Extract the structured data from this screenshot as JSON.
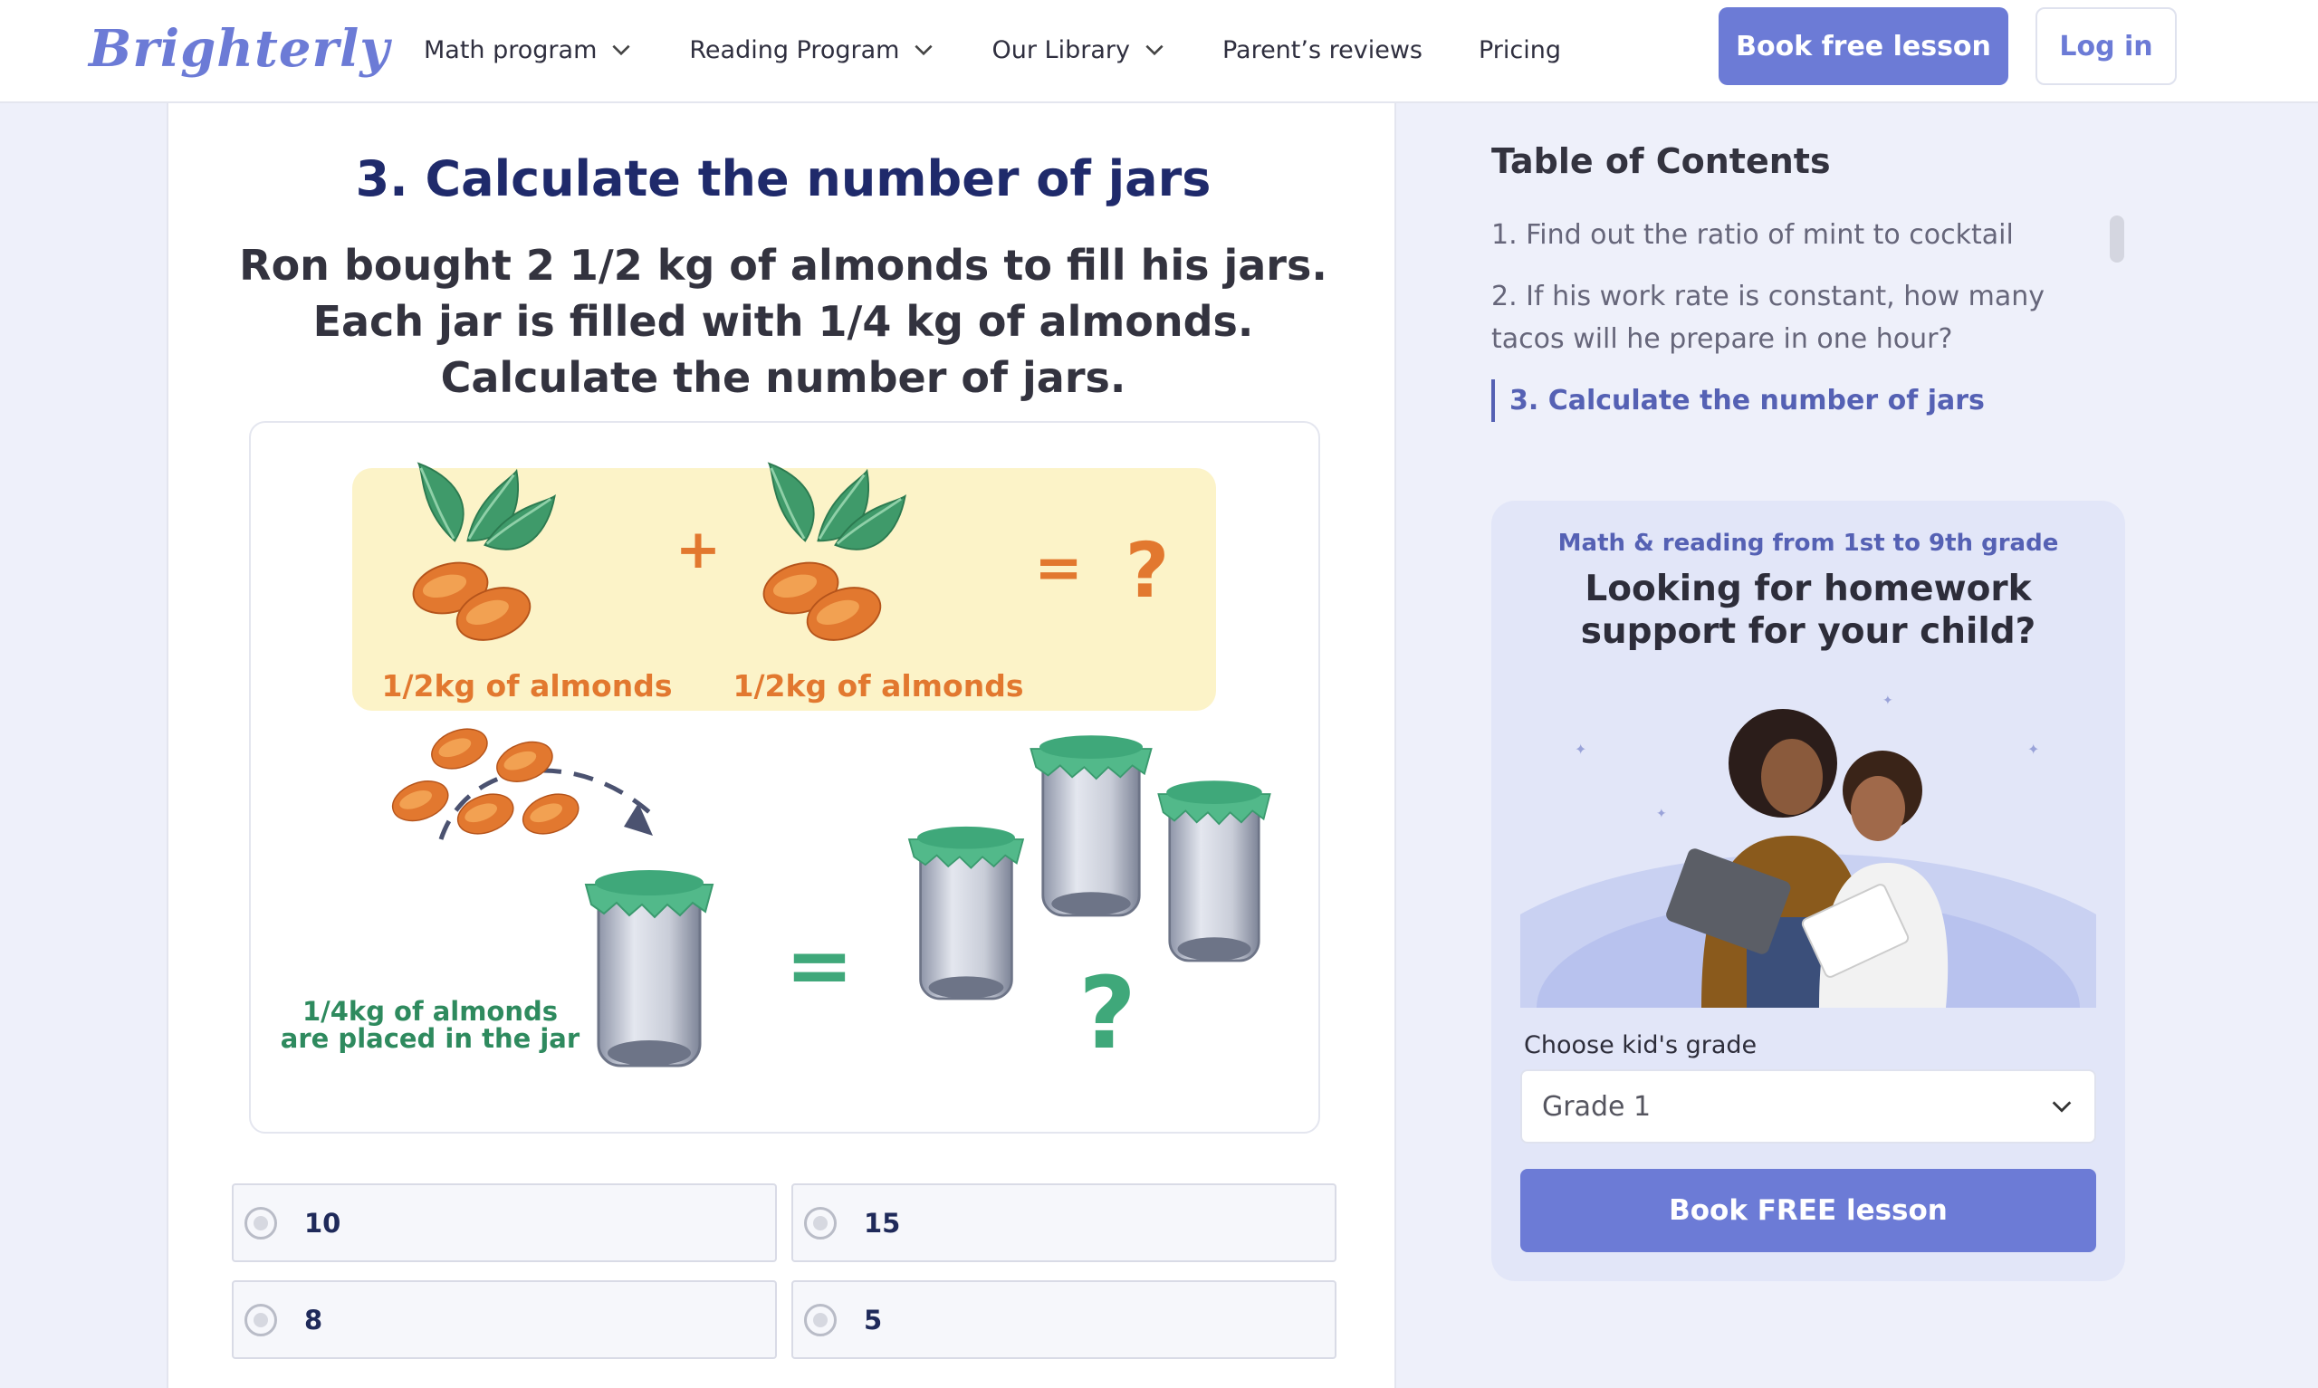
{
  "header": {
    "logo_text": "Brighterly",
    "nav": [
      {
        "label": "Math program"
      },
      {
        "label": "Reading Program"
      },
      {
        "label": "Our Library"
      },
      {
        "label": "Parent’s reviews"
      },
      {
        "label": "Pricing"
      }
    ],
    "book_label": "Book free lesson",
    "login_label": "Log in"
  },
  "question": {
    "title": "3. Calculate the number of jars",
    "text": "Ron bought 2 1/2 kg of almonds to fill his jars. Each jar is filled with 1/4  kg of almonds. Calculate the number of jars.",
    "illustration": {
      "left_caption": "1/2kg of almonds",
      "right_caption": "1/2kg of almonds",
      "plus": "+",
      "equals": "=",
      "question_mark": "?",
      "jar_caption_line1": "1/4kg  of  almonds",
      "jar_caption_line2": "are placed in the jar"
    },
    "options": [
      {
        "label": "10"
      },
      {
        "label": "15"
      },
      {
        "label": "8"
      },
      {
        "label": "5"
      }
    ]
  },
  "toc": {
    "title": "Table of Contents",
    "items": [
      {
        "label": "1. Find out the ratio of mint to cocktail"
      },
      {
        "label": "2. If his work rate is constant, how many tacos will he prepare in one hour?"
      },
      {
        "label": "3. Calculate the number of jars"
      }
    ]
  },
  "promo": {
    "subtitle": "Math & reading from 1st to 9th grade",
    "title": "Looking for homework support for your child?",
    "grade_label": "Choose kid's grade",
    "grade_value": "Grade 1",
    "button_label": "Book FREE lesson"
  },
  "colors": {
    "accent": "#6c7bd6",
    "title_navy": "#1f2a6b",
    "almond_orange": "#e2782f",
    "jar_green": "#3fa87a",
    "panel_yellow": "#fcf3c8"
  }
}
